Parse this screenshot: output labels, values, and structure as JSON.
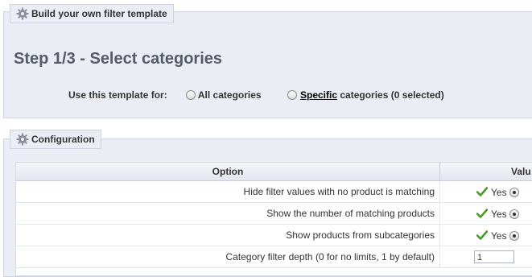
{
  "step_fieldset": {
    "legend": "Build your own filter template",
    "title": "Step 1/3 - Select categories",
    "use_template_label": "Use this template for:",
    "option_all": "All categories",
    "option_specific_link": "Specific",
    "option_specific_suffix": " categories (0 selected)"
  },
  "config_fieldset": {
    "legend": "Configuration",
    "columns": {
      "option": "Option",
      "value": "Valu"
    },
    "rows": [
      {
        "label": "Hide filter values with no product is matching",
        "value": "Yes"
      },
      {
        "label": "Show the number of matching products",
        "value": "Yes"
      },
      {
        "label": "Show products from subcategories",
        "value": "Yes"
      },
      {
        "label": "Category filter depth (0 for no limits, 1 by default)",
        "value": "1"
      }
    ]
  },
  "colors": {
    "fieldset_bg": "#ebedf4",
    "check_green": "#4a9a2a"
  },
  "icons": [
    "gear-icon",
    "check-icon",
    "radio-button"
  ]
}
